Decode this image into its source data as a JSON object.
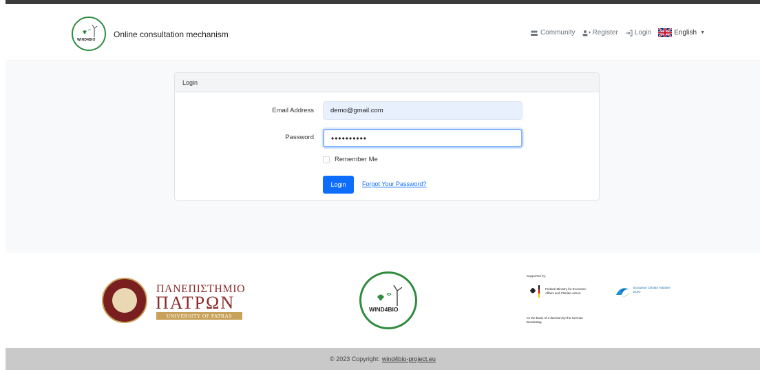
{
  "header": {
    "brand_logo_text": "WIND4BIO",
    "title": "Online consultation mechanism",
    "nav": {
      "community": "Community",
      "register": "Register",
      "login": "Login",
      "language": "English"
    }
  },
  "login_card": {
    "header": "Login",
    "email_label": "Email Address",
    "email_value": "demo@gmail.com",
    "password_label": "Password",
    "password_value": "••••••••••",
    "remember_label": "Remember Me",
    "login_button": "Login",
    "forgot_link": "Forgot Your Password?"
  },
  "footer_logos": {
    "university_line1": "ΠΑΝΕΠΙΣΤΗΜΙΟ",
    "university_line2": "ΠΑΤΡΩΝ",
    "university_line3": "UNIVERSITY OF PATRAS",
    "wind4bio_logo_text": "WIND4BIO",
    "supported_by": "Supported by:",
    "ministry_text": "Federal Ministry for Economic Affairs and Climate Action",
    "ministry_basis": "on the basis of a decision by the German Bundestag",
    "euki_text": "European Climate Initiative EUKI"
  },
  "footer": {
    "copyright_prefix": "© 2023 Copyright:",
    "copyright_link": "wind4bio-project.eu"
  },
  "colors": {
    "primary": "#0d6efd",
    "brand_green": "#2e8b3e",
    "footer_bg": "#c9c9c9"
  }
}
